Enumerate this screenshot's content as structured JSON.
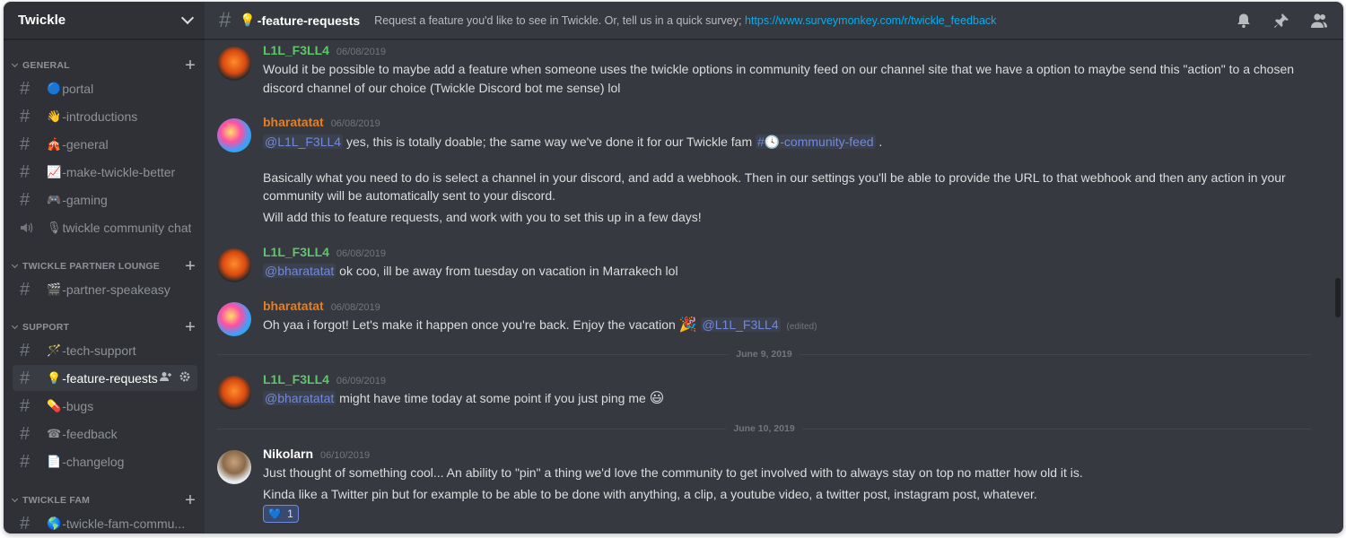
{
  "server": {
    "name": "Twickle"
  },
  "sidebar": {
    "categories": [
      {
        "name": "GENERAL"
      },
      {
        "name": "TWICKLE PARTNER LOUNGE"
      },
      {
        "name": "SUPPORT"
      },
      {
        "name": "TWICKLE FAM"
      }
    ],
    "channels": [
      {
        "emoji": "🔵",
        "name": "portal"
      },
      {
        "emoji": "👋",
        "name": "-introductions"
      },
      {
        "emoji": "🎪",
        "name": "-general"
      },
      {
        "emoji": "📈",
        "name": "-make-twickle-better"
      },
      {
        "emoji": "🎮",
        "name": "-gaming"
      },
      {
        "emoji": "🎙",
        "name": "twickle community chat"
      },
      {
        "emoji": "🎬",
        "name": "-partner-speakeasy"
      },
      {
        "emoji": "🪄",
        "name": "-tech-support"
      },
      {
        "emoji": "💡",
        "name": "-feature-requests"
      },
      {
        "emoji": "💊",
        "name": "-bugs"
      },
      {
        "emoji": "☎",
        "name": "-feedback"
      },
      {
        "emoji": "📄",
        "name": "-changelog"
      },
      {
        "emoji": "🌎",
        "name": "-twickle-fam-commu..."
      }
    ]
  },
  "topbar": {
    "channel_emoji": "💡",
    "channel_name": "-feature-requests",
    "topic": "Request a feature you'd like to see in Twickle. Or, tell us in a quick survey;",
    "topic_link": "https://www.surveymonkey.com/r/twickle_feedback"
  },
  "messages": [
    {
      "author": "L1L_F3LL4",
      "time": "06/08/2019",
      "lines": [
        "Would it be possible to maybe add a feature when someone uses the twickle options in community feed on our channel site that we have a option to maybe send this \"action\" to a chosen",
        "discord channel of our choice (Twickle Discord bot me sense) lol"
      ]
    },
    {
      "author": "bharatatat",
      "time": "06/08/2019",
      "mention": "@L1L_F3LL4",
      "text1": "yes, this is totally doable; the same way we've done it for our Twickle fam",
      "channel_mention": "-community-feed",
      "text1_end": ".",
      "lines": [
        "Basically what you need to do is select a channel in your discord, and add a webhook. Then in our settings you'll be able to provide the URL to that webhook and then any action in your",
        "community will be automatically sent to your discord.",
        "Will add this to feature requests, and work with you to set this up in a few days!"
      ]
    },
    {
      "author": "L1L_F3LL4",
      "time": "06/08/2019",
      "mention": "@bharatatat",
      "text": "ok coo, ill be away from tuesday on vacation in Marrakech lol"
    },
    {
      "author": "bharatatat",
      "time": "06/08/2019",
      "text": "Oh yaa i forgot! Let's make it happen once you're back. Enjoy the vacation",
      "emoji": "🎉",
      "mention": "@L1L_F3LL4",
      "edited": "(edited)"
    },
    {
      "author": "L1L_F3LL4",
      "time": "06/09/2019",
      "mention": "@bharatatat",
      "text": "might have time today at some point if you just ping me",
      "emoji": "😃"
    },
    {
      "author": "Nikolarn",
      "time": "06/10/2019",
      "lines": [
        "Just thought of something cool... An ability to \"pin\" a thing we'd love the community to get involved with to always stay on top no matter how old it is.",
        "Kinda like a Twitter pin but for example to be able to be done with anything, a clip, a youtube video, a twitter post, instagram post, whatever."
      ],
      "reaction": {
        "emoji": "💙",
        "count": "1"
      }
    }
  ],
  "date_dividers": [
    "June 9, 2019",
    "June 10, 2019"
  ],
  "icons": {
    "bell": "bell-icon",
    "pin": "pin-icon",
    "members": "members-icon",
    "add_member": "add-member-icon",
    "settings": "gear-icon"
  },
  "colors": {
    "accent_link": "#00b0f4",
    "mention": "#7289da",
    "green_user": "#5ec66b",
    "orange_user": "#e67e22"
  }
}
